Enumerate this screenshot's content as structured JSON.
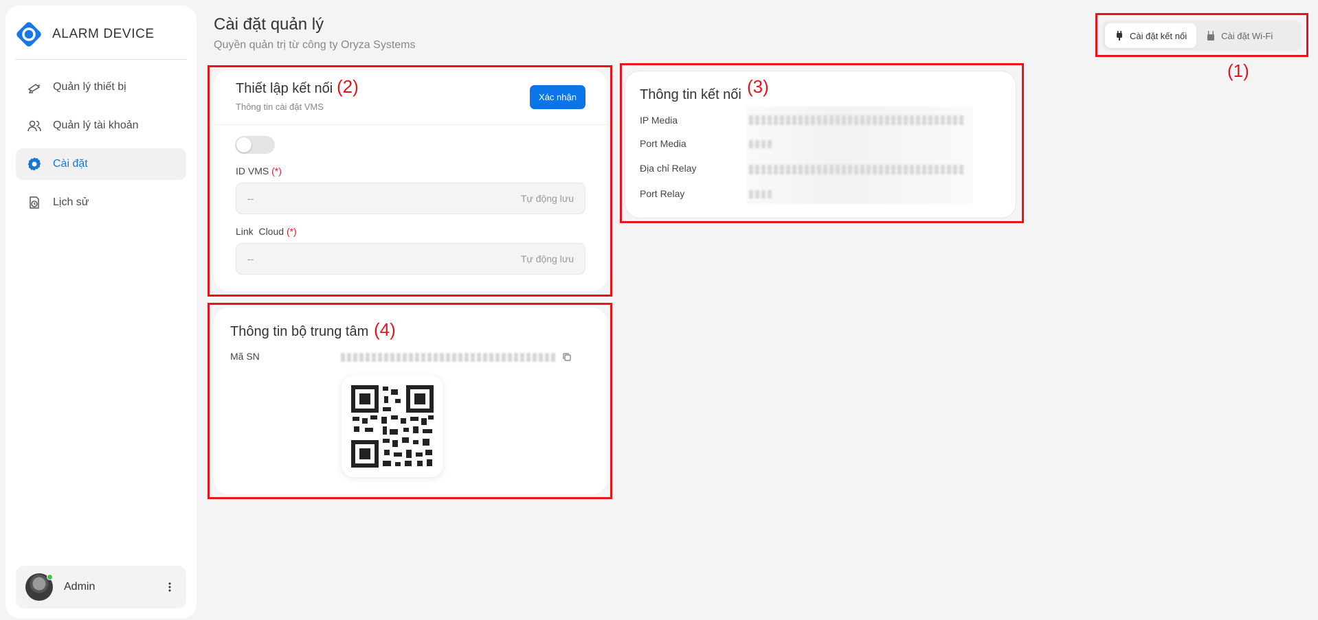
{
  "app": {
    "logo_text": "ALARM DEVICE"
  },
  "sidebar": {
    "items": [
      {
        "label": "Quản lý thiết bị",
        "icon": "camera-icon"
      },
      {
        "label": "Quản lý tài khoản",
        "icon": "users-icon"
      },
      {
        "label": "Cài đặt",
        "icon": "gear-icon",
        "active": true
      },
      {
        "label": "Lịch sử",
        "icon": "history-icon"
      }
    ],
    "user": {
      "name": "Admin"
    }
  },
  "header": {
    "title": "Cài đặt quản lý",
    "subtitle": "Quyền quản trị từ công ty Oryza Systems"
  },
  "tabs": [
    {
      "label": "Cài đặt kết nối",
      "icon": "plug-icon",
      "active": true
    },
    {
      "label": "Cài đặt Wi-Fi",
      "icon": "router-icon",
      "active": false
    }
  ],
  "annotations": [
    "(1)",
    "(2)",
    "(3)",
    "(4)"
  ],
  "connection_setup": {
    "title": "Thiết lập kết nối",
    "subtitle": "Thông tin cài đặt VMS",
    "confirm_label": "Xác nhận",
    "toggle_on": false,
    "fields": [
      {
        "label": "ID VMS",
        "required": "(*)",
        "value": "--",
        "hint": "Tự động lưu"
      },
      {
        "label": "Link  Cloud",
        "required": "(*)",
        "value": "--",
        "hint": "Tự động lưu"
      }
    ]
  },
  "connection_info": {
    "title": "Thông tin kết nối",
    "rows": [
      {
        "label": "IP Media"
      },
      {
        "label": "Port Media"
      },
      {
        "label": "Địa chỉ Relay"
      },
      {
        "label": "Port Relay"
      }
    ]
  },
  "central_unit": {
    "title": "Thông tin bộ trung tâm",
    "sn_label": "Mã SN"
  },
  "colors": {
    "accent": "#0b74e6",
    "annotation": "#e8131b",
    "active_nav": "#1976d2"
  }
}
